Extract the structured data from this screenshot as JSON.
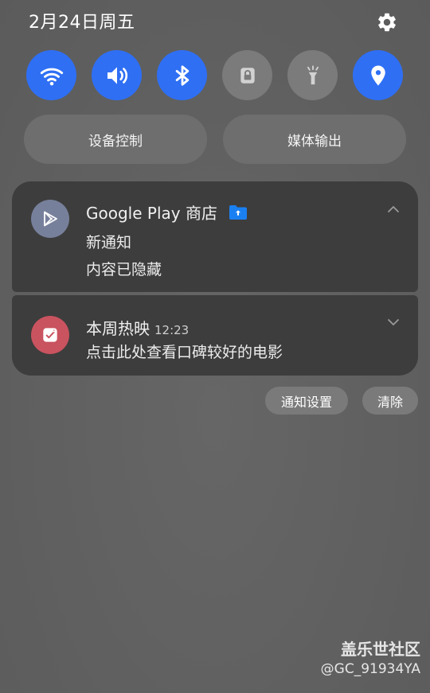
{
  "status": {
    "date": "2月24日周五"
  },
  "quick_toggles": [
    {
      "icon": "wifi-icon",
      "state": "on"
    },
    {
      "icon": "sound-icon",
      "state": "on"
    },
    {
      "icon": "bluetooth-icon",
      "state": "on"
    },
    {
      "icon": "lock-icon",
      "state": "off"
    },
    {
      "icon": "flashlight-icon",
      "state": "off"
    },
    {
      "icon": "location-icon",
      "state": "on"
    }
  ],
  "panel_buttons": {
    "device_control": "设备控制",
    "media_output": "媒体输出"
  },
  "notifications": [
    {
      "app": "Google Play 商店",
      "title": "新通知",
      "body": "内容已隐藏",
      "expanded": true
    },
    {
      "app": "本周热映",
      "time": "12:23",
      "body": "点击此处查看口碑较好的电影",
      "expanded": false
    }
  ],
  "actions": {
    "notification_settings": "通知设置",
    "clear": "清除"
  },
  "watermark": {
    "line1": "盖乐世社区",
    "line2": "@GC_91934YA"
  },
  "colors": {
    "accent": "#2f6ff4",
    "card": "#3d3d3d",
    "background": "#616161"
  }
}
